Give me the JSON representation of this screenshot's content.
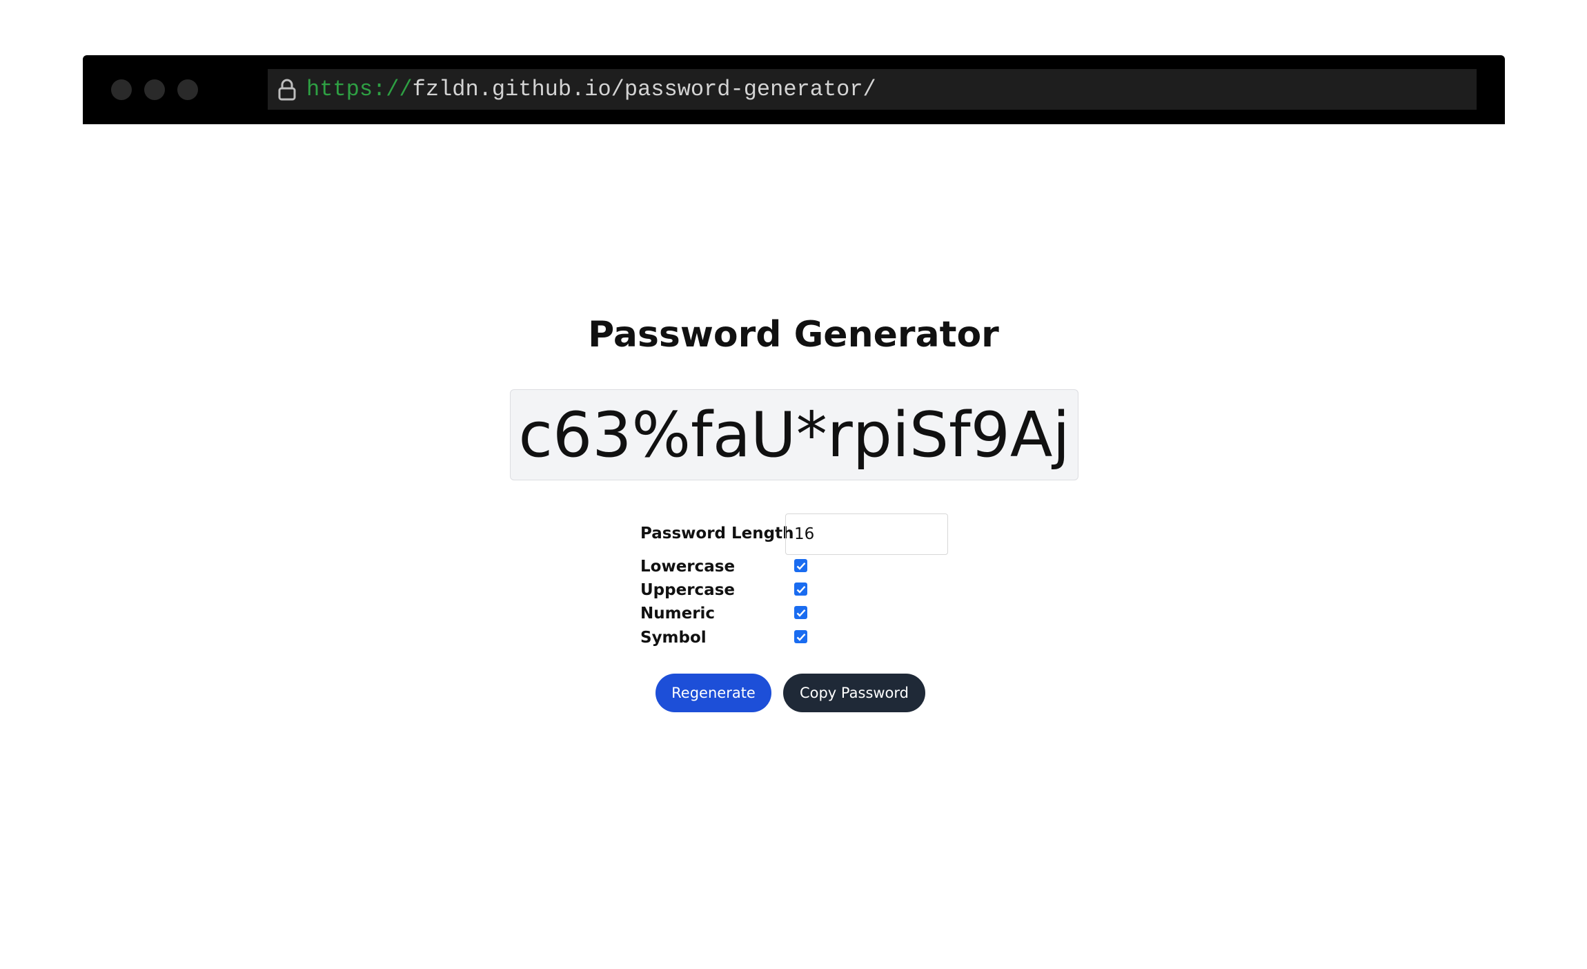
{
  "browser": {
    "url_protocol": "https://",
    "url_rest": "fzldn.github.io/password-generator/"
  },
  "page": {
    "title": "Password Generator",
    "password": "c63%faU*rpiSf9Aj"
  },
  "settings": {
    "length_label": "Password Length",
    "length_value": "16",
    "options": [
      {
        "label": "Lowercase",
        "checked": true
      },
      {
        "label": "Uppercase",
        "checked": true
      },
      {
        "label": "Numeric",
        "checked": true
      },
      {
        "label": "Symbol",
        "checked": true
      }
    ]
  },
  "actions": {
    "regenerate_label": "Regenerate",
    "copy_label": "Copy Password"
  },
  "colors": {
    "regenerate_bg": "#1d4fd8",
    "copy_bg": "#1f2937",
    "checkbox_accent": "#1a6cf0",
    "url_protocol": "#2ea043"
  }
}
